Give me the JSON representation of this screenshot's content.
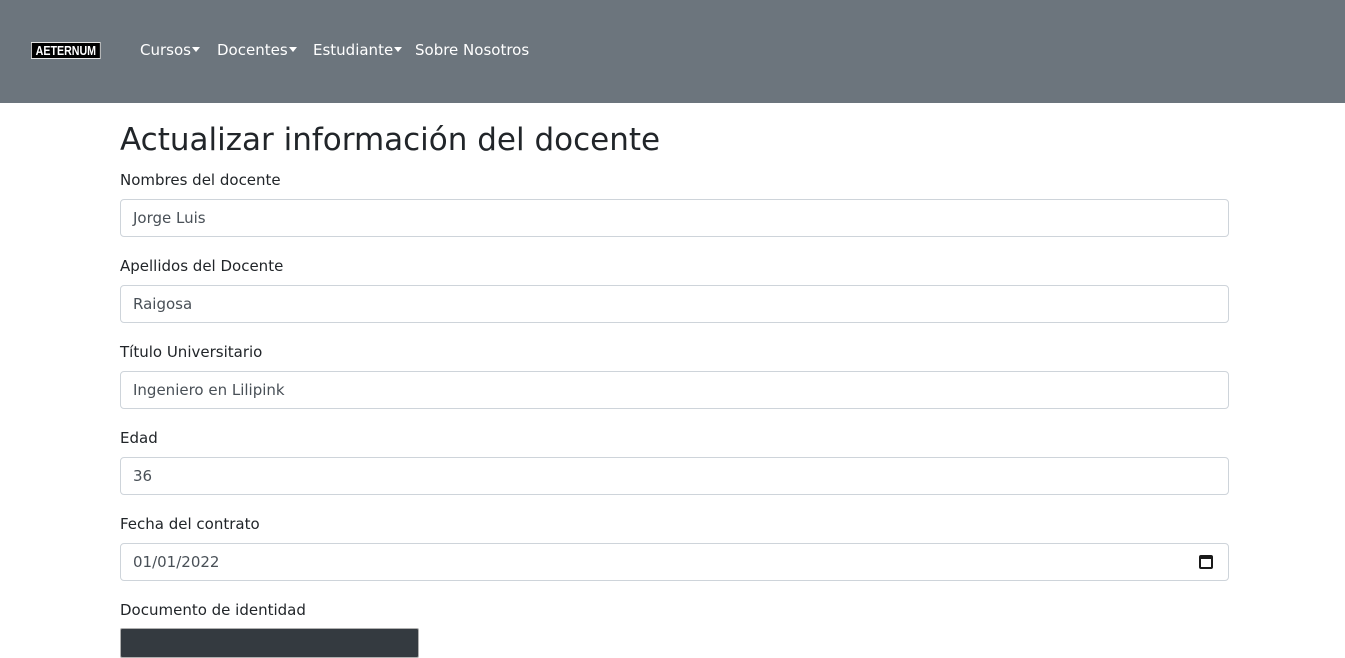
{
  "navbar": {
    "brand": "AETERNUM",
    "items": [
      {
        "label": "Cursos",
        "dropdown": true
      },
      {
        "label": "Docentes",
        "dropdown": true
      },
      {
        "label": "Estudiante",
        "dropdown": true
      },
      {
        "label": "Sobre Nosotros",
        "dropdown": false
      }
    ]
  },
  "page": {
    "title": "Actualizar información del docente"
  },
  "form": {
    "nombres": {
      "label": "Nombres del docente",
      "value": "Jorge Luis"
    },
    "apellidos": {
      "label": "Apellidos del Docente",
      "value": "Raigosa"
    },
    "titulo": {
      "label": "Título Universitario",
      "value": "Ingeniero en Lilipink"
    },
    "edad": {
      "label": "Edad",
      "value": "36"
    },
    "fecha": {
      "label": "Fecha del contrato",
      "value": "01/01/2022",
      "icon": "calendar-icon"
    },
    "documento": {
      "label": "Documento de identidad"
    }
  },
  "colors": {
    "navbar": "#6c757d",
    "text": "#212529",
    "input_border": "#ced4da",
    "file_box": "#343a40"
  }
}
